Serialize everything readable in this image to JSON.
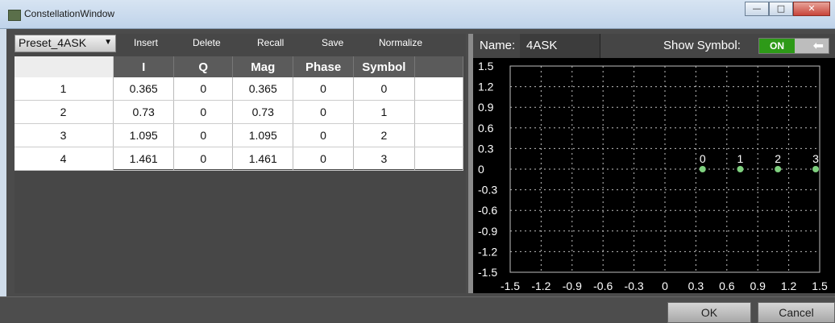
{
  "window": {
    "title": "ConstellationWindow"
  },
  "toolbar": {
    "preset_value": "Preset_4ASK",
    "insert": "Insert",
    "delete": "Delete",
    "recall": "Recall",
    "save": "Save",
    "normalize": "Normalize"
  },
  "table": {
    "columns": [
      "I",
      "Q",
      "Mag",
      "Phase",
      "Symbol"
    ],
    "rows": [
      {
        "index": "1",
        "I": "0.365",
        "Q": "0",
        "Mag": "0.365",
        "Phase": "0",
        "Symbol": "0"
      },
      {
        "index": "2",
        "I": "0.73",
        "Q": "0",
        "Mag": "0.73",
        "Phase": "0",
        "Symbol": "1"
      },
      {
        "index": "3",
        "I": "1.095",
        "Q": "0",
        "Mag": "1.095",
        "Phase": "0",
        "Symbol": "2"
      },
      {
        "index": "4",
        "I": "1.461",
        "Q": "0",
        "Mag": "1.461",
        "Phase": "0",
        "Symbol": "3"
      }
    ]
  },
  "panel": {
    "name_label": "Name:",
    "name_value": "4ASK",
    "show_symbol_label": "Show Symbol:",
    "toggle_state": "ON",
    "toggle_icon": "arrow-left-icon"
  },
  "chart_data": {
    "type": "scatter",
    "xlim": [
      -1.5,
      1.5
    ],
    "ylim": [
      -1.5,
      1.5
    ],
    "xticks": [
      "-1.5",
      "-1.2",
      "-0.9",
      "-0.6",
      "-0.3",
      "0",
      "0.3",
      "0.6",
      "0.9",
      "1.2",
      "1.5"
    ],
    "yticks": [
      "1.5",
      "1.2",
      "0.9",
      "0.6",
      "0.3",
      "0",
      "-0.3",
      "-0.6",
      "-0.9",
      "-1.2",
      "-1.5"
    ],
    "grid": true,
    "point_color": "#7fd17f",
    "points": [
      {
        "x": 0.365,
        "y": 0,
        "label": "0"
      },
      {
        "x": 0.73,
        "y": 0,
        "label": "1"
      },
      {
        "x": 1.095,
        "y": 0,
        "label": "2"
      },
      {
        "x": 1.461,
        "y": 0,
        "label": "3"
      }
    ]
  },
  "footer": {
    "ok": "OK",
    "cancel": "Cancel"
  }
}
